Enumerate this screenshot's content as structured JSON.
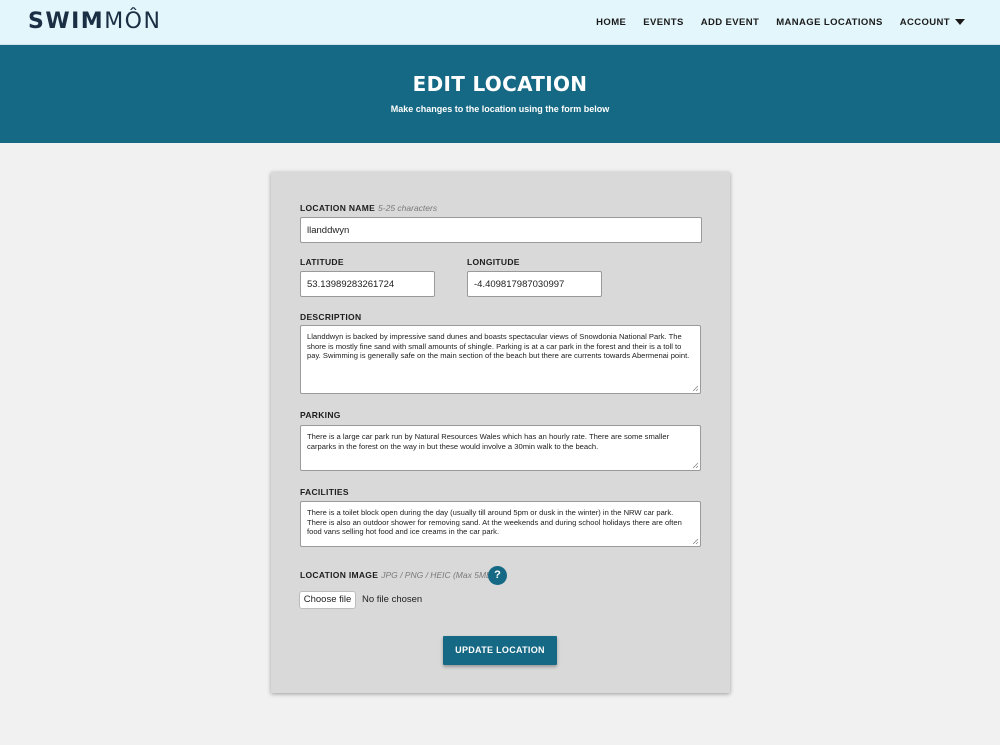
{
  "brand": {
    "logo_bold": "SWIM",
    "logo_light": "MÔN"
  },
  "nav": {
    "items": [
      {
        "label": "HOME"
      },
      {
        "label": "EVENTS"
      },
      {
        "label": "ADD EVENT"
      },
      {
        "label": "MANAGE LOCATIONS"
      },
      {
        "label": "ACCOUNT"
      }
    ]
  },
  "hero": {
    "title": "EDIT LOCATION",
    "subtitle": "Make changes to the location using the form below"
  },
  "form": {
    "name": {
      "label": "LOCATION NAME",
      "hint": "5-25 characters",
      "value": "llanddwyn"
    },
    "latitude": {
      "label": "LATITUDE",
      "value": "53.13989283261724"
    },
    "longitude": {
      "label": "LONGITUDE",
      "value": "-4.409817987030997"
    },
    "description": {
      "label": "DESCRIPTION",
      "value": "Llanddwyn is backed by impressive sand dunes and boasts spectacular views of Snowdonia National Park.  The shore is mostly fine sand with small amounts of shingle.  Parking is at a car park in the forest and their is a toll to pay.  Swimming is generally safe on the main section of the beach but there are currents towards Abermenai point."
    },
    "parking": {
      "label": "PARKING",
      "value": "There is a large car park run by Natural Resources Wales which has an hourly rate. There are some smaller carparks in the forest on the way in but these would involve a 30min walk to the beach."
    },
    "facilities": {
      "label": "FACILITIES",
      "value": "There is a toilet block open during the day (usually till around 5pm or dusk in the winter) in the NRW car park. There is also an outdoor shower for removing sand. At the weekends and during school holidays there are often food vans selling hot food and ice creams in the car park."
    },
    "image": {
      "label": "LOCATION IMAGE",
      "hint": "JPG / PNG / HEIC (Max 5MB)",
      "help_glyph": "?",
      "choose_label": "Choose file",
      "no_file_text": "No file chosen"
    },
    "submit_label": "UPDATE LOCATION"
  },
  "colors": {
    "accent": "#166984",
    "navbar_bg": "#e3f6fb",
    "page_bg": "#f1f1f1",
    "card_bg": "#d9d9d9"
  },
  "icons": {
    "account_dropdown": "caret-down-icon",
    "help": "question-circle-icon",
    "resize": "resize-grip-icon"
  }
}
